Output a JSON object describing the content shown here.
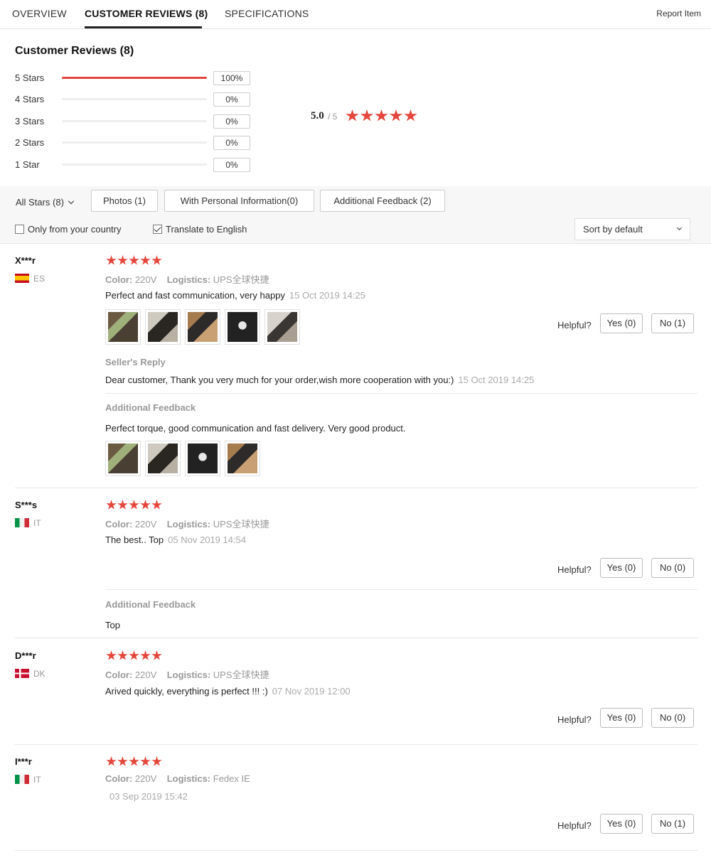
{
  "tabs": {
    "overview": "OVERVIEW",
    "reviews": "CUSTOMER REVIEWS (8)",
    "specs": "SPECIFICATIONS",
    "report": "Report Item"
  },
  "summary": {
    "title": "Customer Reviews (8)",
    "rows": [
      {
        "label": "5 Stars",
        "pct": "100%",
        "fraction": 1.0
      },
      {
        "label": "4 Stars",
        "pct": "0%",
        "fraction": 0
      },
      {
        "label": "3 Stars",
        "pct": "0%",
        "fraction": 0
      },
      {
        "label": "2 Stars",
        "pct": "0%",
        "fraction": 0
      },
      {
        "label": "1 Star",
        "pct": "0%",
        "fraction": 0
      }
    ],
    "average": "5.0",
    "out_of": "/ 5",
    "average_stars": 5
  },
  "filters": {
    "all_stars": "All Stars (8)",
    "photos": "Photos (1)",
    "personal": "With Personal Information(0)",
    "additional": "Additional Feedback (2)",
    "only_country": "Only from your country",
    "only_country_checked": false,
    "translate": "Translate to English",
    "translate_checked": true,
    "sort": "Sort by default"
  },
  "labels": {
    "color": "Color:",
    "logistics": "Logistics:",
    "helpful": "Helpful?",
    "sellers_reply": "Seller's Reply",
    "additional_feedback": "Additional Feedback"
  },
  "reviews": [
    {
      "name": "X***r",
      "country": "ES",
      "stars": 5,
      "color": "220V",
      "logistics": "UPS全球快捷",
      "text": "Perfect and fast communication, very happy",
      "date": "15 Oct 2019 14:25",
      "photo_count": 5,
      "seller_reply": "Dear customer, Thank you very much for your order,wish more cooperation with you:)",
      "seller_reply_date": "15 Oct 2019 14:25",
      "additional_feedback": "Perfect torque, good communication and fast delivery. Very good product.",
      "additional_photo_count": 4,
      "yes": "Yes (0)",
      "no": "No (1)"
    },
    {
      "name": "S***s",
      "country": "IT",
      "stars": 5,
      "color": "220V",
      "logistics": "UPS全球快捷",
      "text": "The best.. Top",
      "date": "05 Nov 2019 14:54",
      "additional_feedback": "Top",
      "yes": "Yes (0)",
      "no": "No (0)"
    },
    {
      "name": "D***r",
      "country": "DK",
      "stars": 5,
      "color": "220V",
      "logistics": "UPS全球快捷",
      "text": "Arived quickly, everything is perfect !!! :)",
      "date": "07 Nov 2019 12:00",
      "yes": "Yes (0)",
      "no": "No (0)"
    },
    {
      "name": "I***r",
      "country": "IT",
      "stars": 5,
      "color": "220V",
      "logistics": "Fedex IE",
      "text": "",
      "date": "03 Sep 2019 15:42",
      "yes": "Yes (0)",
      "no": "No (1)"
    }
  ],
  "colors": {
    "accent": "#e5463c",
    "muted": "#999999"
  }
}
